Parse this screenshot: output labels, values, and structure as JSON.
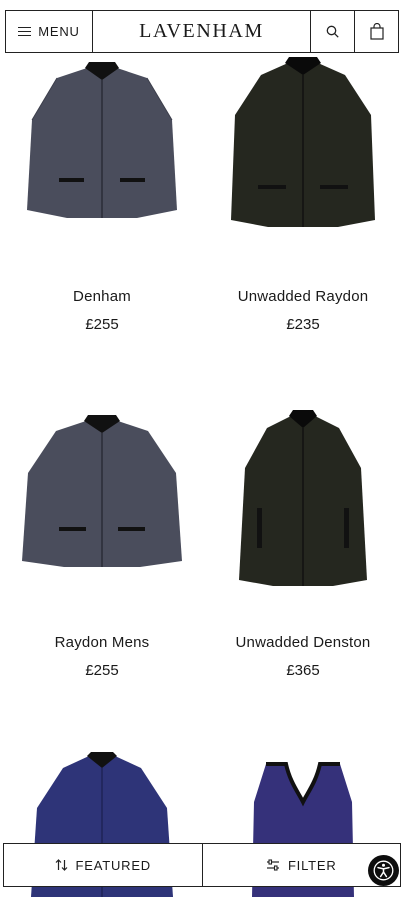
{
  "header": {
    "menu_label": "MENU",
    "logo_text": "LAVENHAM",
    "icons": [
      "menu-icon",
      "search-icon",
      "bag-icon"
    ]
  },
  "products": [
    {
      "name": "Denham",
      "price": "£255",
      "color": "#4a4d5c"
    },
    {
      "name": "Unwadded Raydon",
      "price": "£235",
      "color": "#25271f"
    },
    {
      "name": "Raydon Mens",
      "price": "£255",
      "color": "#4a4d5c"
    },
    {
      "name": "Unwadded Denston",
      "price": "£365",
      "color": "#25271f"
    },
    {
      "name": "",
      "price": "",
      "color": "#2e3478"
    },
    {
      "name": "",
      "price": "",
      "color": "#35317a"
    }
  ],
  "bottom_bar": {
    "sort_label": "FEATURED",
    "filter_label": "FILTER"
  },
  "accessibility": {
    "icon": "accessibility-icon"
  }
}
